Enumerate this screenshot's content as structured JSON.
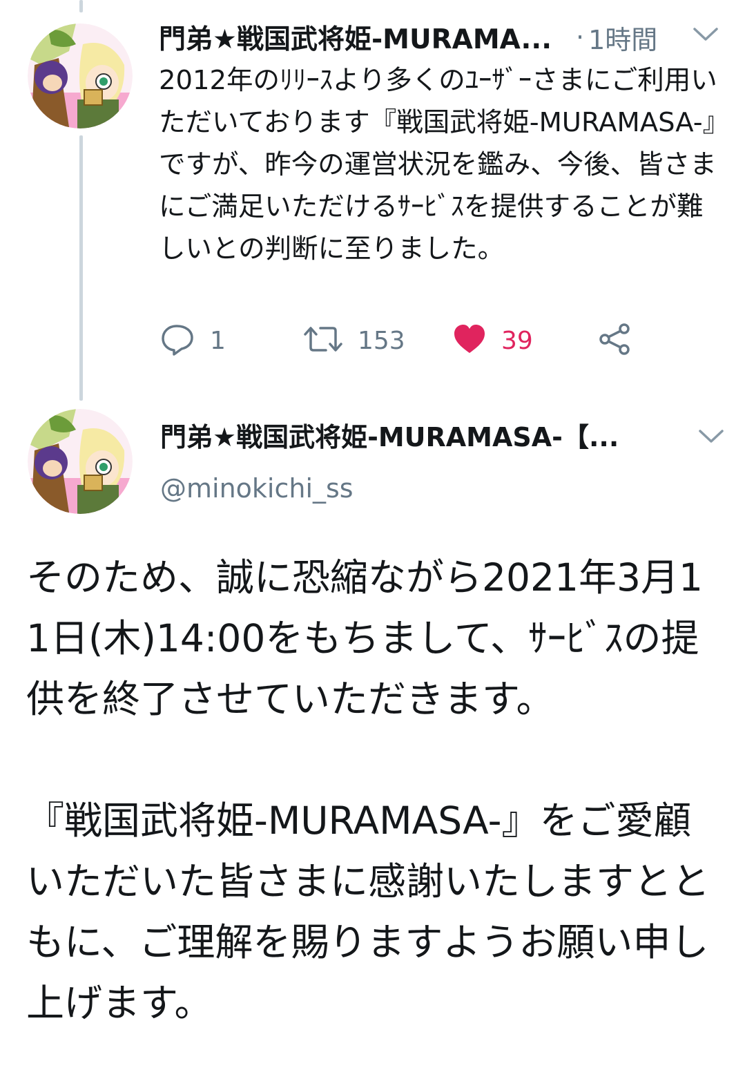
{
  "colors": {
    "text": "#14171a",
    "muted": "#657786",
    "like": "#e0245e",
    "thread_line": "#ccd6dd"
  },
  "tweet1": {
    "author_name": "門弟★戦国武将姫-MURAMA...",
    "separator": "·",
    "timestamp": "1時間",
    "text": "2012年のﾘﾘｰｽより多くのﾕｰｻﾞｰさまにご利用いただいております『戦国武将姫-MURAMASA-』ですが、昨今の運営状況を鑑み、今後、皆さまにご満足いただけるｻｰﾋﾞｽを提供することが難しいとの判断に至りました。",
    "actions": {
      "reply_count": "1",
      "retweet_count": "153",
      "like_count": "39"
    },
    "icons": [
      "reply-icon",
      "retweet-icon",
      "heart-icon",
      "share-icon",
      "chevron-down-icon"
    ]
  },
  "tweet2": {
    "author_name": "門弟★戦国武将姫-MURAMASA-【...",
    "handle": "@minokichi_ss",
    "paragraph1": "そのため、誠に恐縮ながら2021年3月11日(木)14:00をもちまして、ｻｰﾋﾞｽの提供を終了させていただきます。",
    "paragraph2": "『戦国武将姫-MURAMASA-』をご愛顧いただいた皆さまに感謝いたしますとともに、ご理解を賜りますようお願い申し上げます。"
  }
}
